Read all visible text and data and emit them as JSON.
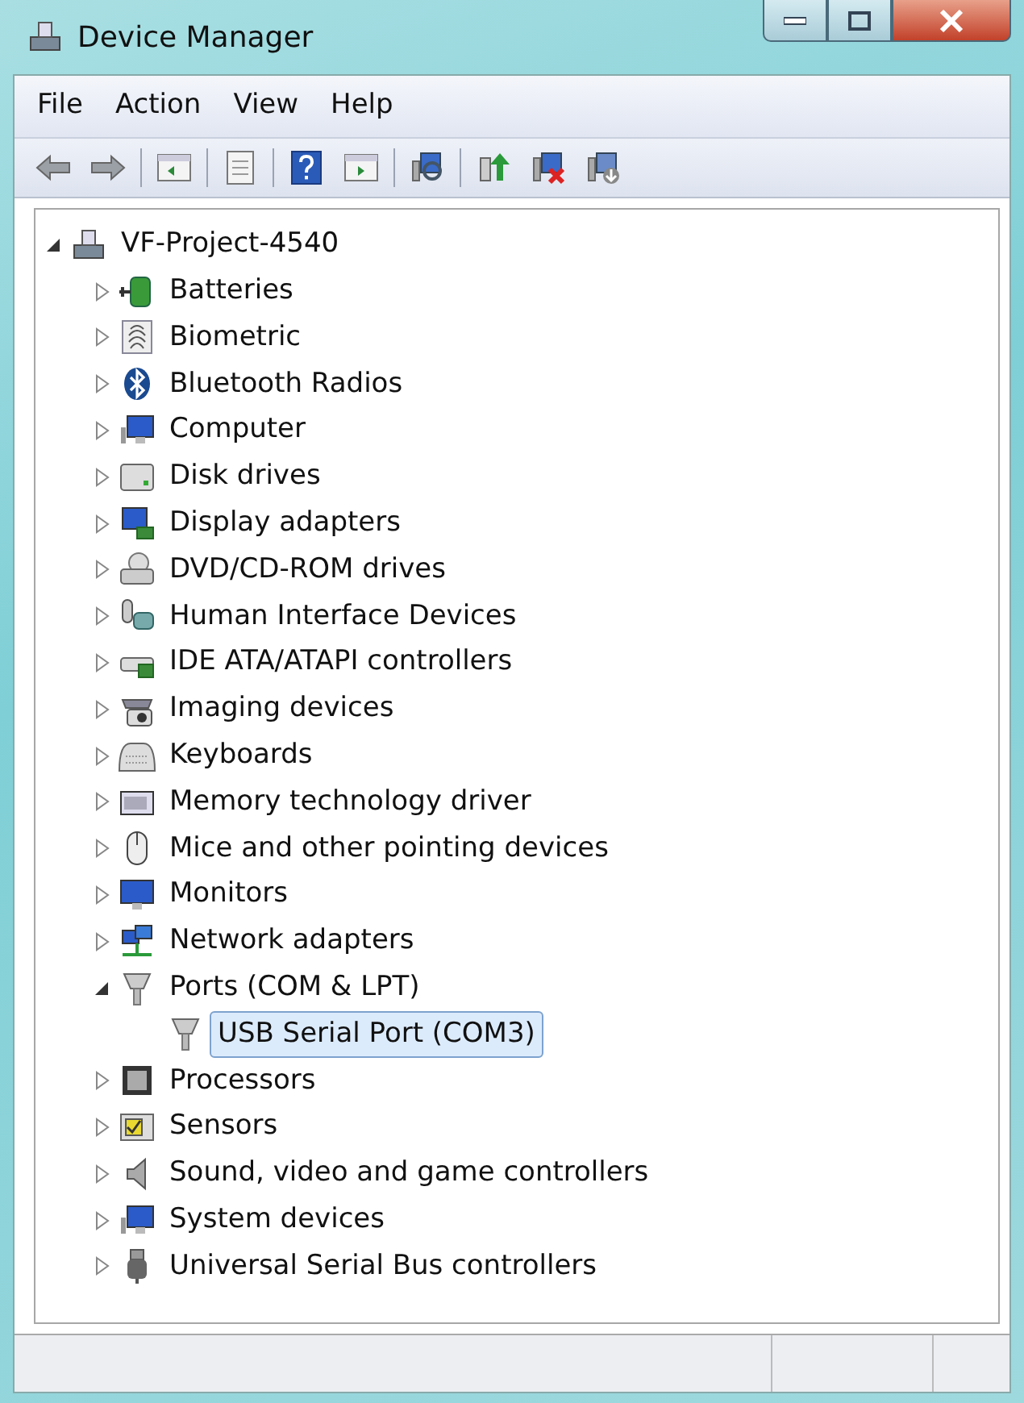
{
  "window": {
    "title": "Device Manager"
  },
  "menu": [
    "File",
    "Action",
    "View",
    "Help"
  ],
  "tree": [
    {
      "label": "VF-Project-4540",
      "expanded": true,
      "selected": false,
      "children": [
        {
          "label": "Batteries",
          "expanded": false,
          "selected": false
        },
        {
          "label": "Biometric",
          "expanded": false,
          "selected": false
        },
        {
          "label": "Bluetooth Radios",
          "expanded": false,
          "selected": false
        },
        {
          "label": "Computer",
          "expanded": false,
          "selected": false
        },
        {
          "label": "Disk drives",
          "expanded": false,
          "selected": false
        },
        {
          "label": "Display adapters",
          "expanded": false,
          "selected": false
        },
        {
          "label": "DVD/CD-ROM drives",
          "expanded": false,
          "selected": false
        },
        {
          "label": "Human Interface Devices",
          "expanded": false,
          "selected": false
        },
        {
          "label": "IDE ATA/ATAPI controllers",
          "expanded": false,
          "selected": false
        },
        {
          "label": "Imaging devices",
          "expanded": false,
          "selected": false
        },
        {
          "label": "Keyboards",
          "expanded": false,
          "selected": false
        },
        {
          "label": "Memory technology driver",
          "expanded": false,
          "selected": false
        },
        {
          "label": "Mice and other pointing devices",
          "expanded": false,
          "selected": false
        },
        {
          "label": "Monitors",
          "expanded": false,
          "selected": false
        },
        {
          "label": "Network adapters",
          "expanded": false,
          "selected": false
        },
        {
          "label": "Ports (COM & LPT)",
          "expanded": true,
          "selected": false,
          "children": [
            {
              "label": "USB Serial Port (COM3)",
              "selected": true
            }
          ]
        },
        {
          "label": "Processors",
          "expanded": false,
          "selected": false
        },
        {
          "label": "Sensors",
          "expanded": false,
          "selected": false
        },
        {
          "label": "Sound, video and game controllers",
          "expanded": false,
          "selected": false
        },
        {
          "label": "System devices",
          "expanded": false,
          "selected": false
        },
        {
          "label": "Universal Serial Bus controllers",
          "expanded": false,
          "selected": false
        }
      ]
    }
  ]
}
